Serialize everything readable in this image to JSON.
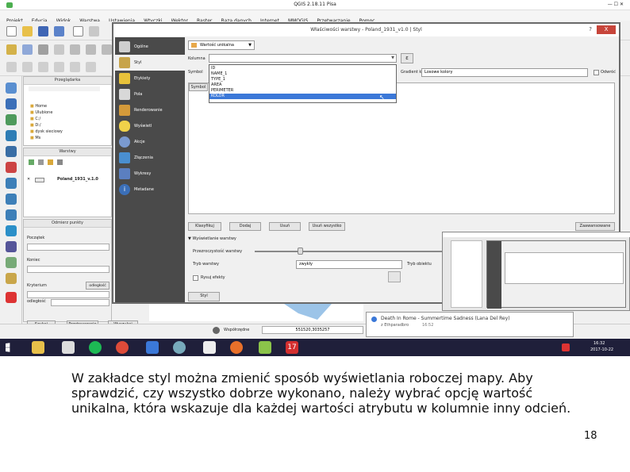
{
  "window": {
    "title": "QGIS 2.18.11 Pisa"
  },
  "menubar": [
    "Projekt",
    "Edycja",
    "Widok",
    "Warstwa",
    "Ustawienia",
    "Wtyczki",
    "Wektor",
    "Raster",
    "Baza danych",
    "Internet",
    "MMQGIS",
    "Przetwarzanie",
    "Pomoc"
  ],
  "panels": {
    "browser_title": "Przeglądarka",
    "browser_items": [
      "Home",
      "Ulubione",
      "C:/",
      "D:/",
      "dysk sieciowy",
      "Ms"
    ],
    "layers_title": "Warstwy",
    "layer_name": "Poland_1931_v.1.0",
    "coords_title": "Odmierz punkty",
    "coords_fields": [
      "Początek",
      "Koniec",
      "Kryterium",
      "odległość"
    ],
    "coords_btn_right": "odległość",
    "bottom_tabs": [
      "Szukaj",
      "Przetwarzanie",
      "Wyszukaj"
    ]
  },
  "dialog": {
    "title": "Właściwości warstwy - Poland_1931_v1.0 | Styl",
    "help": "?",
    "close": "X",
    "sidebar": [
      {
        "label": "Ogólne",
        "icon": "wrench-icon"
      },
      {
        "label": "Styl",
        "icon": "brush-icon"
      },
      {
        "label": "Etykiety",
        "icon": "label-icon"
      },
      {
        "label": "Pola",
        "icon": "table-icon"
      },
      {
        "label": "Renderowanie",
        "icon": "paint-icon"
      },
      {
        "label": "Wyświetl",
        "icon": "speech-icon"
      },
      {
        "label": "Akcje",
        "icon": "gear-icon"
      },
      {
        "label": "Złączenia",
        "icon": "join-icon"
      },
      {
        "label": "Wykresy",
        "icon": "chart-icon"
      },
      {
        "label": "Metadane",
        "icon": "info-icon"
      }
    ],
    "renderer_type": "Wartość unikalna",
    "column_label": "Kolumna",
    "symbol_label": "Symbol",
    "color_ramp_label": "Gradient kolorów",
    "color_ramp_value": "Losowe kolory",
    "invert_label": "Odwróć",
    "symbol_header": "Symbol",
    "expr_btn": "ε",
    "column_options": [
      "ID",
      "NAME_1",
      "TYPE_1",
      "AREA",
      "PERIMETER",
      "KOLOR"
    ],
    "selected_option_index": 5,
    "buttons": [
      "Klasyfikuj",
      "Dodaj",
      "Usuń",
      "Usuń wszystko"
    ],
    "advanced_btn": "Zaawansowane",
    "layer_render_title": "Wyświetlanie warstwy",
    "opacity_label": "Przezroczystość warstwy",
    "blend_layer_label": "Tryb warstwy",
    "blend_layer_value": "zwykły",
    "blend_feature_label": "Tryb obiektu",
    "order_label": "Rysuj efekty",
    "style_btn": "Styl"
  },
  "statusbar": {
    "coord_label": "Współrzędne",
    "coord_value": "551520,3035257"
  },
  "notification": {
    "title": "Death In Rome - Summertime Sadness (Lana Del Rey)",
    "subtitle": "z Ethparadbro",
    "time": "16:52"
  },
  "taskbar": {
    "time": "16:32",
    "date": "2017-10-22"
  },
  "caption": "W zakładce styl można zmienić sposób wyświetlania roboczej mapy. Aby sprawdzić, czy wszystko dobrze wykonano, należy wybrać opcję wartość unikalna, która wskazuje dla każdej wartości atrybutu w kolumnie inny odcień.",
  "page_number": "18"
}
